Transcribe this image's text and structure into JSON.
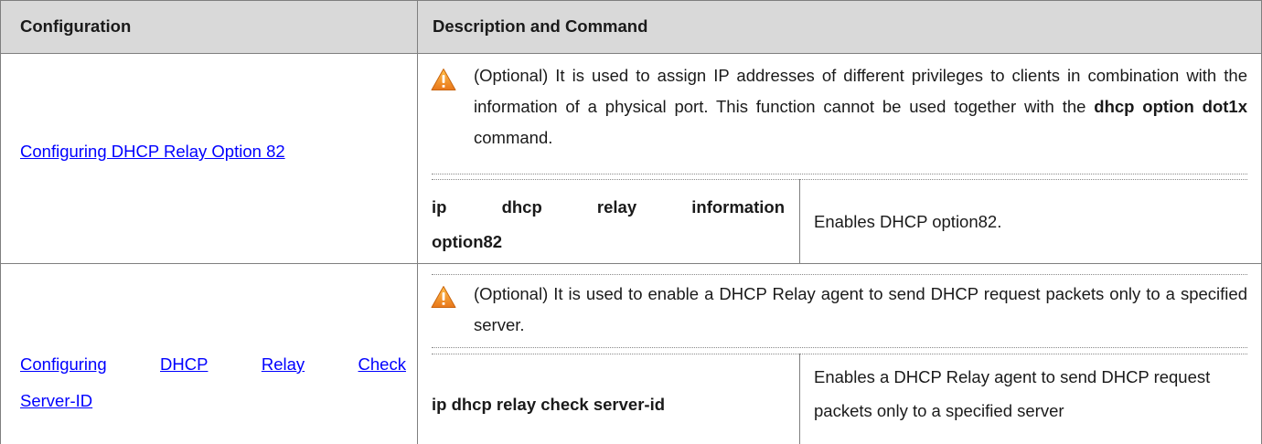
{
  "table": {
    "headers": {
      "configuration": "Configuration",
      "description": "Description and Command"
    },
    "rows": [
      {
        "config_link": "Configuring DHCP Relay Option 82",
        "warning_text_a": "(Optional) It is used to assign IP addresses of different privileges to clients in combination with the information of a physical port. This function cannot be used together with the ",
        "warning_bold": "dhcp option dot1x",
        "warning_text_b": " command.",
        "command_line1_words": [
          "ip",
          "dhcp",
          "relay",
          "information"
        ],
        "command_line2": "option82",
        "command_desc": "Enables DHCP option82."
      },
      {
        "config_link_line1_words": [
          "Configuring",
          "DHCP",
          "Relay",
          "Check"
        ],
        "config_link_line2": "Server-ID",
        "warning_text": "(Optional) It is used to enable a DHCP Relay agent to send DHCP request packets only to a specified server.",
        "command": "ip dhcp relay check server-id",
        "command_desc": "Enables a DHCP Relay agent to send DHCP request packets only to a specified server"
      }
    ]
  },
  "colors": {
    "header_bg": "#d9d9d9",
    "link": "#0000ff",
    "warning_icon": "#f29020"
  },
  "icons": {
    "warning": "warning-triangle-icon"
  }
}
